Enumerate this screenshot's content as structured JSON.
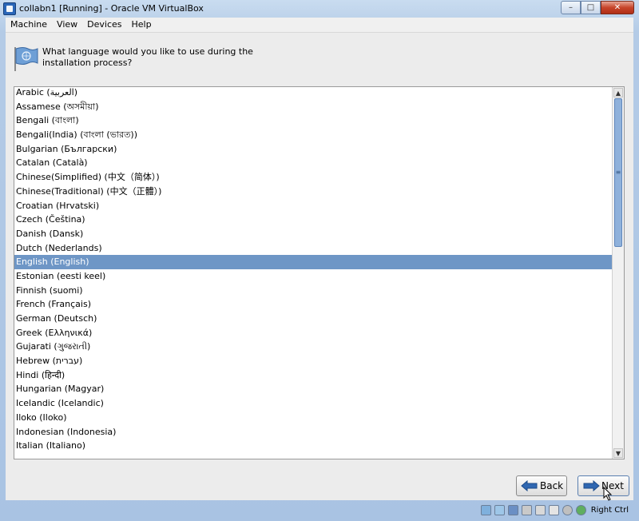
{
  "window": {
    "title": "collabn1 [Running] - Oracle VM VirtualBox",
    "minimize": "–",
    "maximize": "□",
    "close": "✕"
  },
  "menu": [
    "Machine",
    "View",
    "Devices",
    "Help"
  ],
  "installer": {
    "question": "What language would you like to use during the installation process?",
    "languages": [
      "Arabic (العربية)",
      "Assamese (অসমীয়া)",
      "Bengali (বাংলা)",
      "Bengali(India) (বাংলা (ভারত))",
      "Bulgarian (Български)",
      "Catalan (Català)",
      "Chinese(Simplified) (中文（简体）)",
      "Chinese(Traditional) (中文（正體）)",
      "Croatian (Hrvatski)",
      "Czech (Čeština)",
      "Danish (Dansk)",
      "Dutch (Nederlands)",
      "English (English)",
      "Estonian (eesti keel)",
      "Finnish (suomi)",
      "French (Français)",
      "German (Deutsch)",
      "Greek (Ελληνικά)",
      "Gujarati (ગુજરાતી)",
      "Hebrew (עברית)",
      "Hindi (हिन्दी)",
      "Hungarian (Magyar)",
      "Icelandic (Icelandic)",
      "Iloko (Iloko)",
      "Indonesian (Indonesia)",
      "Italian (Italiano)"
    ],
    "selected_index": 12,
    "scroll_up": "▲",
    "scroll_down": "▼",
    "back_label": "Back",
    "next_label": "Next"
  },
  "statusbar": {
    "icons": [
      "hard-disk-icon",
      "optical-disk-icon",
      "network-icon",
      "usb-icon",
      "shared-folders-icon",
      "display-icon",
      "mouse-integration-icon",
      "host-key-icon"
    ],
    "host_key": "Right Ctrl"
  },
  "colors": {
    "selection": "#6e96c6",
    "frame": "#b4cbe6"
  }
}
